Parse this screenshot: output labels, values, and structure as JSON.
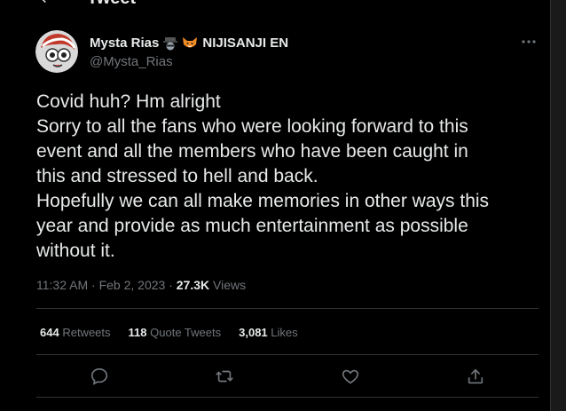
{
  "header": {
    "title": "Tweet"
  },
  "tweet": {
    "author": {
      "name": "Mysta Rias",
      "org": "NIJISANJI EN",
      "handle": "@Mysta_Rias",
      "emoji": [
        "detective-emoji",
        "fox-emoji"
      ]
    },
    "text_lines": [
      "Covid huh? Hm alright",
      "Sorry to all the fans who were looking forward to this",
      "event and all the members who have been caught in",
      "this and stressed to hell and back.",
      "Hopefully we can all make memories in other ways this",
      "year and provide as much entertainment as possible",
      "without it."
    ],
    "time": "11:32 AM",
    "separator": "·",
    "date": "Feb 2, 2023",
    "views_count": "27.3K",
    "views_label": "Views"
  },
  "stats": {
    "retweets_count": "644",
    "retweets_label": "Retweets",
    "quotes_count": "118",
    "quotes_label": "Quote Tweets",
    "likes_count": "3,081",
    "likes_label": "Likes"
  },
  "actions": [
    "reply-icon",
    "retweet-icon",
    "like-icon",
    "share-icon"
  ],
  "colors": {
    "background": "#000000",
    "text": "#e7e9ea",
    "secondary": "#71767b",
    "divider": "#2f3336"
  }
}
